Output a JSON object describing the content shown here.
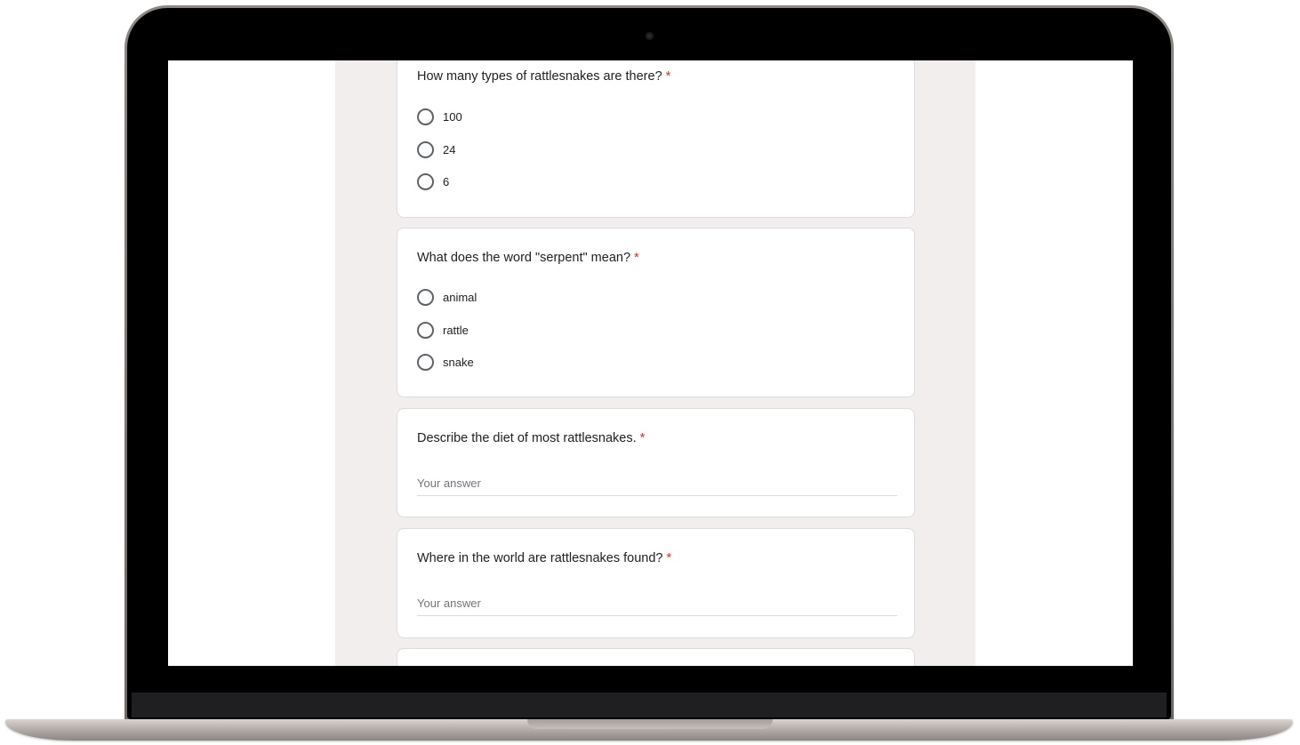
{
  "form": {
    "required_marker": "*",
    "questions": [
      {
        "title": "How many types of rattlesnakes are there?",
        "type": "radio",
        "options": [
          "100",
          "24",
          "6"
        ]
      },
      {
        "title": "What does the word \"serpent\" mean?",
        "type": "radio",
        "options": [
          "animal",
          "rattle",
          "snake"
        ]
      },
      {
        "title": "Describe the diet of most rattlesnakes.",
        "type": "text",
        "placeholder": "Your answer",
        "value": ""
      },
      {
        "title": "Where in the world are rattlesnakes found?",
        "type": "text",
        "placeholder": "Your answer",
        "value": ""
      }
    ]
  },
  "colors": {
    "form_background": "#f3eeee",
    "card_border": "#dadce0",
    "required": "#d93025",
    "text": "#202124"
  }
}
